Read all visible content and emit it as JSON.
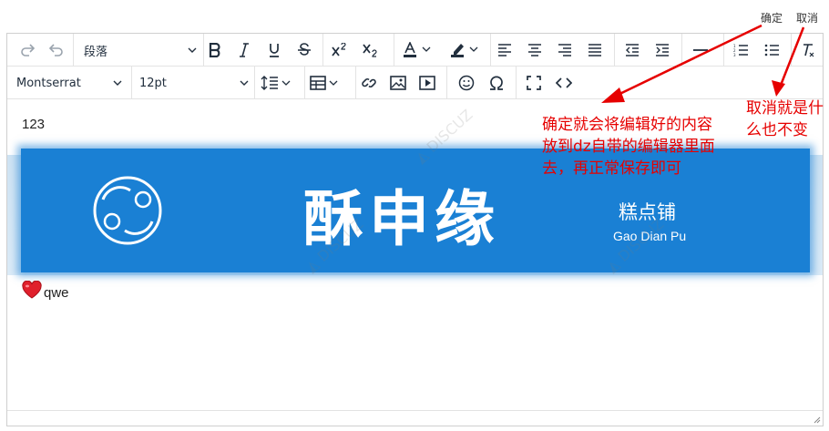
{
  "topbar": {
    "ok_label": "确定",
    "cancel_label": "取消"
  },
  "toolbar": {
    "block_format": "段落",
    "font_family": "Montserrat",
    "font_size": "12pt"
  },
  "content": {
    "line1": "123",
    "banner": {
      "brand": "酥申缘",
      "subtitle": "糕点铺",
      "pinyin": "Gao Dian Pu",
      "logo_text": "缘"
    },
    "emoji_text": "qwe"
  },
  "annotations": {
    "ok_note": "确定就会将编辑好的内容放到dz自带的编辑器里面去，再正常保存即可",
    "cancel_note": "取消就是什么也不变"
  },
  "colors": {
    "accent": "#e60000",
    "banner_blue": "#1a80d4",
    "icon": "#222f3e"
  },
  "icons": [
    "redo-icon",
    "undo-icon",
    "bold-icon",
    "italic-icon",
    "underline-icon",
    "strikethrough-icon",
    "superscript-icon",
    "subscript-icon",
    "text-color-icon",
    "highlight-color-icon",
    "align-left-icon",
    "align-center-icon",
    "align-right-icon",
    "align-justify-icon",
    "outdent-icon",
    "indent-icon",
    "horizontal-rule-icon",
    "numbered-list-icon",
    "bullet-list-icon",
    "clear-format-icon",
    "line-height-icon",
    "table-icon",
    "link-icon",
    "image-icon",
    "media-icon",
    "emoji-icon",
    "special-char-icon",
    "fullscreen-icon",
    "code-icon"
  ]
}
